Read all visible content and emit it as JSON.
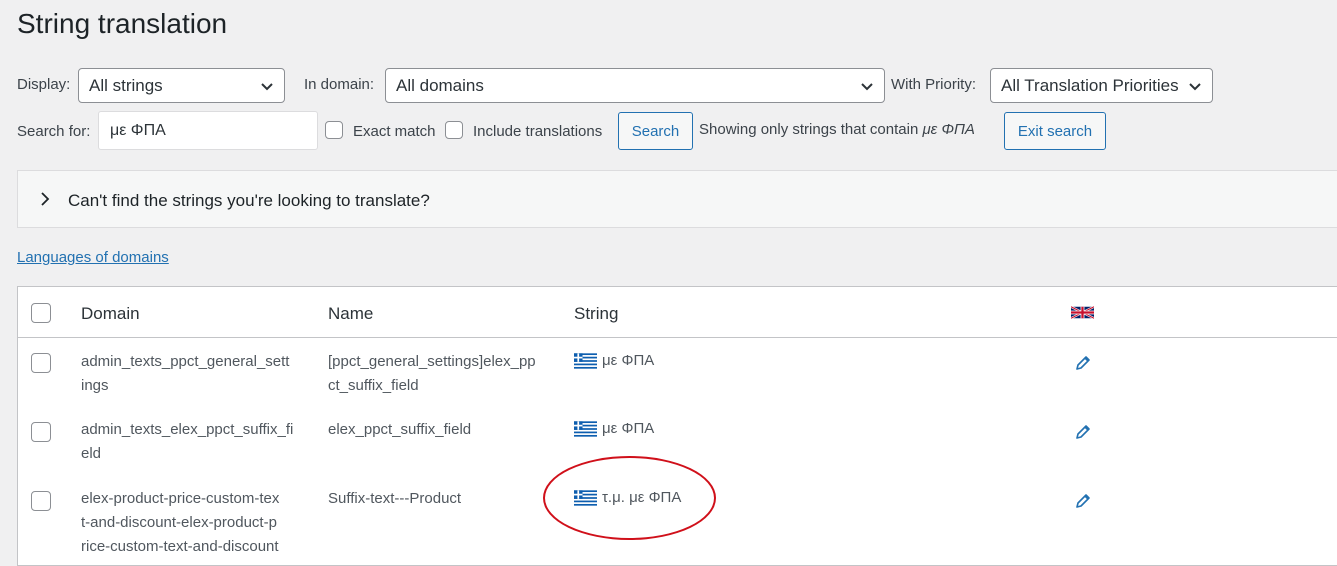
{
  "page": {
    "title": "String translation"
  },
  "filters": {
    "display_label": "Display:",
    "display_value": "All strings",
    "domain_label": "In domain:",
    "domain_value": "All domains",
    "priority_label": "With Priority:",
    "priority_value": "All Translation Priorities",
    "search_label": "Search for:",
    "search_value": "με ΦΠΑ",
    "exact_match_label": "Exact match",
    "include_translations_label": "Include translations",
    "search_button": "Search",
    "showing_prefix": "Showing only strings that contain",
    "showing_term": "με ΦΠΑ",
    "exit_search_button": "Exit search"
  },
  "help_panel": {
    "text": "Can't find the strings you're looking to translate?"
  },
  "languages_link": "Languages of domains",
  "table": {
    "headers": {
      "domain": "Domain",
      "name": "Name",
      "string": "String"
    },
    "header_flag_icon": "uk-flag-icon",
    "rows": [
      {
        "domain_lines": [
          "admin_texts_ppct_general_sett",
          "ings"
        ],
        "name_lines": [
          "[ppct_general_settings]elex_pp",
          "ct_suffix_field"
        ],
        "string": "με ΦΠΑ",
        "string_flag_icon": "greece-flag-icon",
        "edit_icon": "pencil-icon"
      },
      {
        "domain_lines": [
          "admin_texts_elex_ppct_suffix_fi",
          "eld"
        ],
        "name_lines": [
          "elex_ppct_suffix_field"
        ],
        "string": "με ΦΠΑ",
        "string_flag_icon": "greece-flag-icon",
        "edit_icon": "pencil-icon"
      },
      {
        "domain_lines": [
          "elex-product-price-custom-tex",
          "t-and-discount-elex-product-p",
          "rice-custom-text-and-discount"
        ],
        "name_lines": [
          "Suffix-text---Product"
        ],
        "string": "τ.μ. με ΦΠΑ",
        "string_flag_icon": "greece-flag-icon",
        "edit_icon": "pencil-icon"
      }
    ]
  },
  "annotation": {
    "color": "#d0101a"
  },
  "colors": {
    "accent": "#2271b1",
    "background": "#f0f0f1"
  }
}
